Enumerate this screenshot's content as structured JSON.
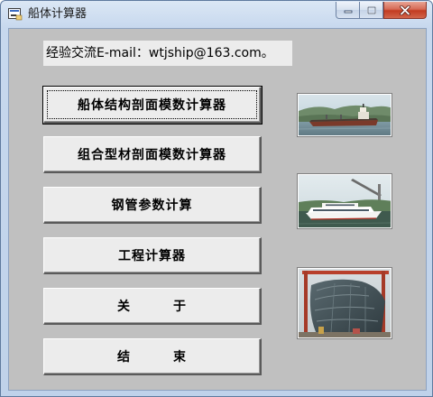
{
  "window": {
    "title": "船体计算器"
  },
  "email": {
    "text": "经验交流E-mail：wtjship@163.com。"
  },
  "buttons": {
    "hull_section": "船体结构剖面模数计算器",
    "combined_section": "组合型材剖面模数计算器",
    "steel_pipe": "钢管参数计算",
    "engineering_calc": "工程计算器",
    "about": "关        于",
    "exit": "结        束"
  },
  "images": [
    {
      "name": "cargo-ship-photo"
    },
    {
      "name": "passenger-ferry-photo"
    },
    {
      "name": "hull-under-construction-photo"
    }
  ]
}
